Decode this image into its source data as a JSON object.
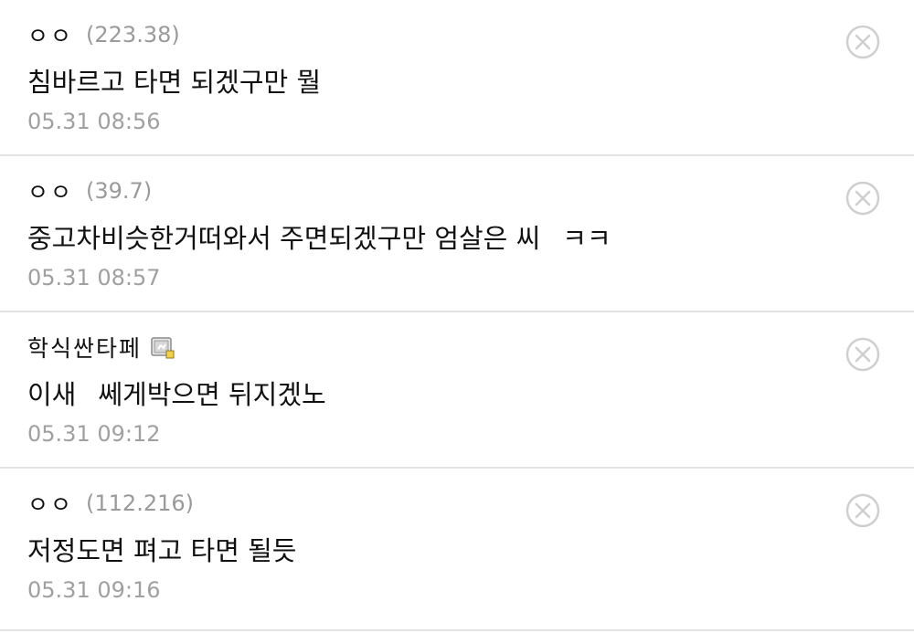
{
  "comments": [
    {
      "nickname": "ㅇㅇ",
      "ip": "(223.38)",
      "text_parts": [
        "침바르고 타면 되겠구만 뭘"
      ],
      "timestamp": "05.31 08:56",
      "has_member_icon": false,
      "delete_icon": "circle-x-icon"
    },
    {
      "nickname": "ㅇㅇ",
      "ip": "(39.7)",
      "text_parts": [
        "중고차비슷한거떠와서 주면되겠구만 엄살은 씨",
        "ㅋㅋ"
      ],
      "timestamp": "05.31 08:57",
      "has_member_icon": false,
      "delete_icon": "circle-x-icon"
    },
    {
      "nickname": "학식싼타페",
      "ip": "",
      "text_parts": [
        "이새",
        "쎄게박으면 뒤지겠노"
      ],
      "timestamp": "05.31 09:12",
      "has_member_icon": true,
      "member_icon": "fixed-nickname-icon",
      "delete_icon": "circle-x-icon"
    },
    {
      "nickname": "ㅇㅇ",
      "ip": "(112.216)",
      "text_parts": [
        "저정도면 펴고 타면 될듯"
      ],
      "timestamp": "05.31 09:16",
      "has_member_icon": false,
      "delete_icon": "circle-x-icon"
    }
  ],
  "colors": {
    "text": "#111111",
    "meta": "#9a9a9a",
    "divider": "#e3e3e3",
    "delete_icon": "#cfcfcf"
  }
}
